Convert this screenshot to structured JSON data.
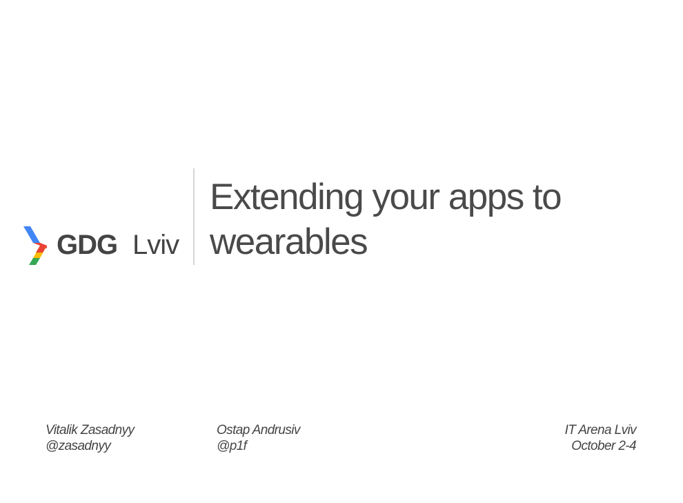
{
  "slide": {
    "logo": {
      "wordmark": "GDG",
      "city": "Lviv",
      "colors": {
        "blue": "#4285f4",
        "red": "#ea4335",
        "green": "#34a853",
        "yellow": "#fbbc05",
        "text": "#444444"
      }
    },
    "title": {
      "line1": "Extending your apps to",
      "line2": "wearables"
    },
    "authors": [
      {
        "name": "Vitalik Zasadnyy",
        "handle": "@zasadnyy"
      },
      {
        "name": "Ostap Andrusiv",
        "handle": "@p1f"
      }
    ],
    "event": {
      "name": "IT Arena Lviv",
      "date": "October 2-4"
    }
  }
}
